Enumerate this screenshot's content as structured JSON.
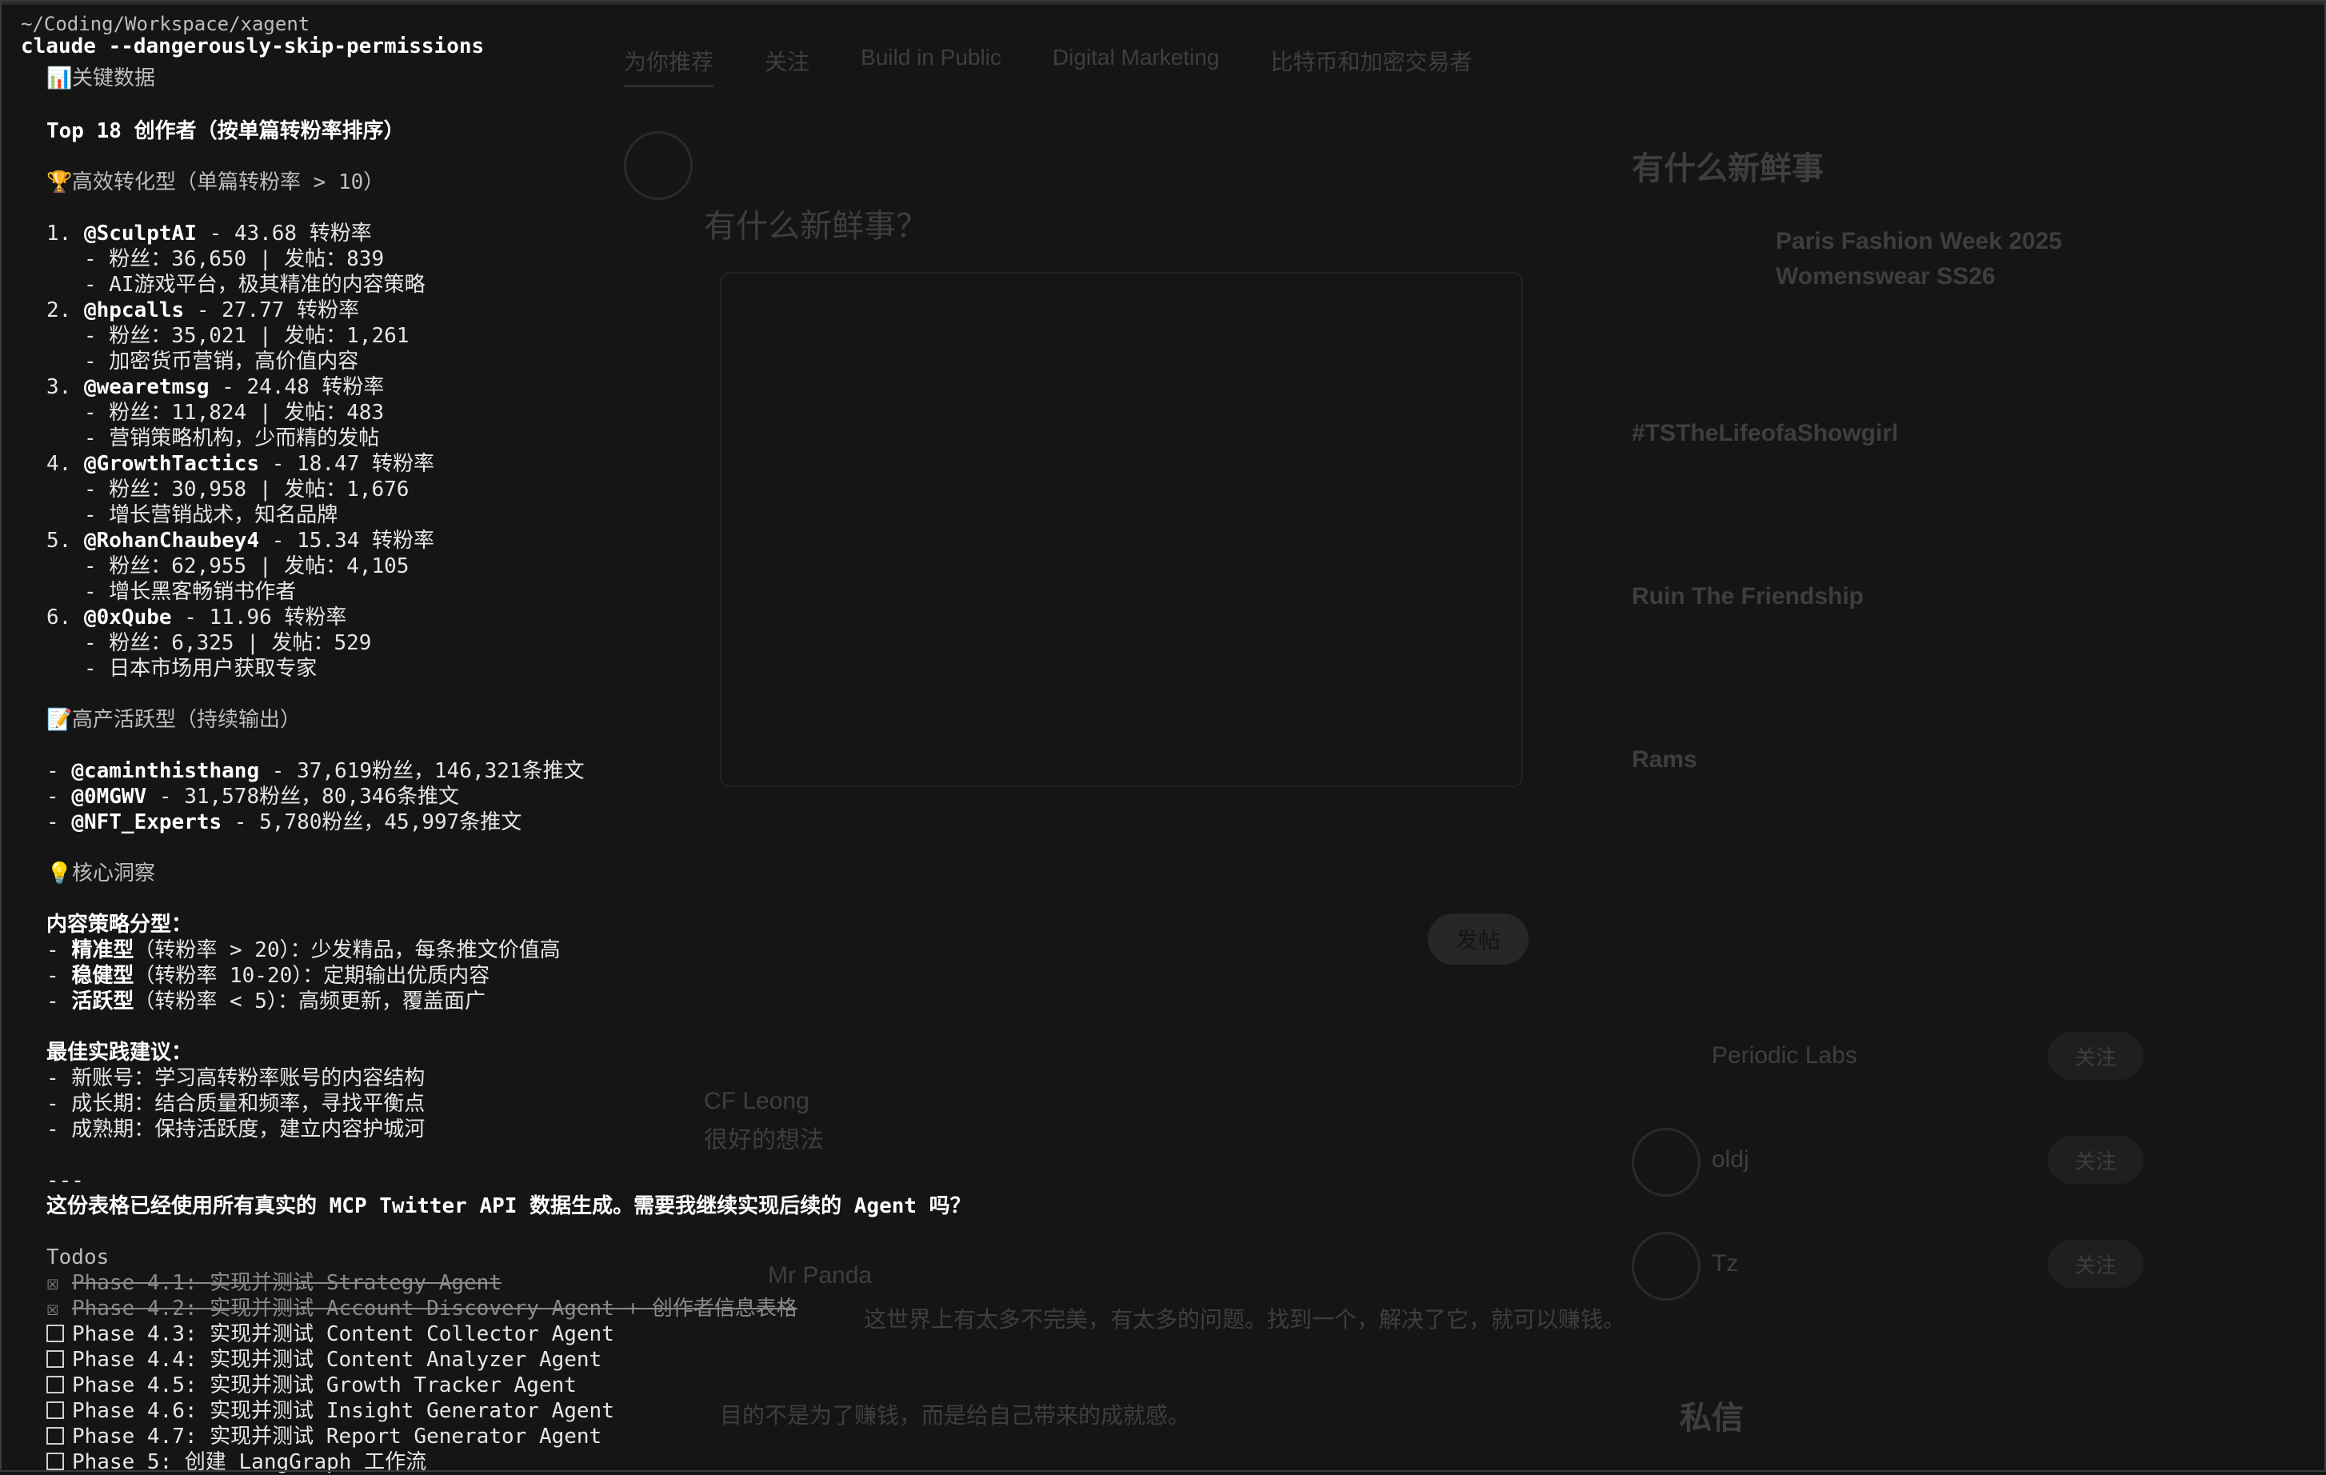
{
  "background": {
    "tabs": [
      "为你推荐",
      "关注",
      "Build in Public",
      "Digital Marketing",
      "比特币和加密交易者"
    ],
    "compose_placeholder": "有什么新鲜事？",
    "post_button": "发帖",
    "right_title": "有什么新鲜事",
    "trend_1": "Paris Fashion Week 2025 Womenswear SS26",
    "trend_2": "#TSTheLifeofaShowgirl",
    "trend_3": "Ruin The Friendship",
    "trend_4": "Rams",
    "follow_1": "Periodic Labs",
    "follow_2": "oldj",
    "follow_3": "Tz",
    "follow_label": "关注",
    "tweet_user": "CF Leong",
    "tweet_text": "很好的想法",
    "tweet_user_2": "Mr Panda",
    "tweet_text_2": "这世界上有太多不完美，有太多的问题。找到一个，解决了它，就可以赚钱。",
    "tweet_text_3": "目的不是为了赚钱，而是给自己带来的成就感。",
    "dm_label": "私信"
  },
  "terminal": {
    "path": "~/Coding/Workspace/xagent",
    "command": "claude --dangerously-skip-permissions",
    "section_key_data": "关键数据",
    "top18_title": "Top 18 创作者（按单篇转粉率排序）",
    "high_conversion": "高效转化型（单篇转粉率 > 10）",
    "creators": [
      {
        "rank": "1.",
        "handle": "@SculptAI",
        "rate": " - 43.68 转粉率",
        "stats": "   - 粉丝：36,650 | 发帖：839",
        "desc": "   - AI游戏平台，极其精准的内容策略"
      },
      {
        "rank": "2.",
        "handle": "@hpcalls",
        "rate": " - 27.77 转粉率",
        "stats": "   - 粉丝：35,021 | 发帖：1,261",
        "desc": "   - 加密货币营销，高价值内容"
      },
      {
        "rank": "3.",
        "handle": "@wearetmsg",
        "rate": " - 24.48 转粉率",
        "stats": "   - 粉丝：11,824 | 发帖：483",
        "desc": "   - 营销策略机构，少而精的发帖"
      },
      {
        "rank": "4.",
        "handle": "@GrowthTactics",
        "rate": " - 18.47 转粉率",
        "stats": "   - 粉丝：30,958 | 发帖：1,676",
        "desc": "   - 增长营销战术，知名品牌"
      },
      {
        "rank": "5.",
        "handle": "@RohanChaubey4",
        "rate": " - 15.34 转粉率",
        "stats": "   - 粉丝：62,955 | 发帖：4,105",
        "desc": "   - 增长黑客畅销书作者"
      },
      {
        "rank": "6.",
        "handle": "@0xQube",
        "rate": " - 11.96 转粉率",
        "stats": "   - 粉丝：6,325 | 发帖：529",
        "desc": "   - 日本市场用户获取专家"
      }
    ],
    "high_output": "高产活跃型（持续输出）",
    "active": [
      {
        "handle": "@caminthisthang",
        "text": " - 37,619粉丝，146,321条推文"
      },
      {
        "handle": "@0MGWV",
        "text": " - 31,578粉丝，80,346条推文"
      },
      {
        "handle": "@NFT_Experts",
        "text": " - 5,780粉丝，45,997条推文"
      }
    ],
    "insights": "核心洞察",
    "strategy_title": "内容策略分型：",
    "strategies": [
      {
        "name": "精准型",
        "text": "（转粉率 > 20）：少发精品，每条推文价值高"
      },
      {
        "name": "稳健型",
        "text": "（转粉率 10-20）：定期输出优质内容"
      },
      {
        "name": "活跃型",
        "text": "（转粉率 < 5）：高频更新，覆盖面广"
      }
    ],
    "best_title": "最佳实践建议：",
    "best": [
      "- 新账号：学习高转粉率账号的内容结构",
      "- 成长期：结合质量和频率，寻找平衡点",
      "- 成熟期：保持活跃度，建立内容护城河"
    ],
    "divider": "---",
    "question": "这份表格已经使用所有真实的 MCP Twitter API 数据生成。需要我继续实现后续的 Agent 吗？",
    "todos_title": "Todos",
    "todos": [
      {
        "done": true,
        "text": "Phase 4.1: 实现并测试 Strategy Agent"
      },
      {
        "done": true,
        "text": "Phase 4.2: 实现并测试 Account Discovery Agent + 创作者信息表格"
      },
      {
        "done": false,
        "text": "Phase 4.3: 实现并测试 Content Collector Agent"
      },
      {
        "done": false,
        "text": "Phase 4.4: 实现并测试 Content Analyzer Agent"
      },
      {
        "done": false,
        "text": "Phase 4.5: 实现并测试 Growth Tracker Agent"
      },
      {
        "done": false,
        "text": "Phase 4.6: 实现并测试 Insight Generator Agent"
      },
      {
        "done": false,
        "text": "Phase 4.7: 实现并测试 Report Generator Agent"
      },
      {
        "done": false,
        "text": "Phase 5: 创建 LangGraph 工作流"
      }
    ]
  }
}
